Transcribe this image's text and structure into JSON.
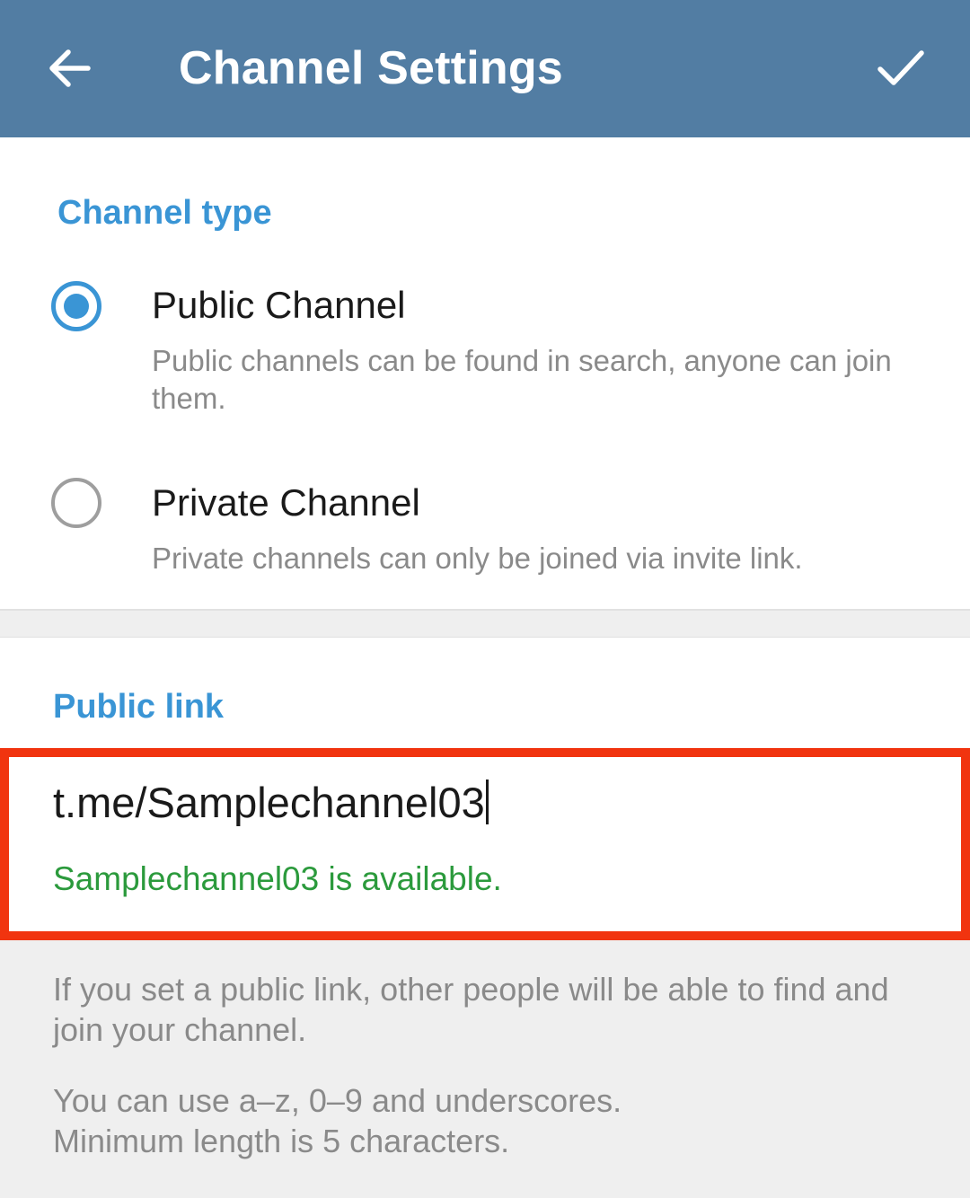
{
  "app_bar": {
    "back_icon": "arrow-left-icon",
    "title": "Channel Settings",
    "done_icon": "checkmark-icon",
    "background_color": "#527da3"
  },
  "channel_type": {
    "header": "Channel type",
    "options": [
      {
        "label": "Public Channel",
        "description": "Public channels can be found in search, anyone can join them.",
        "selected": true
      },
      {
        "label": "Private Channel",
        "description": "Private channels can only be joined via invite link.",
        "selected": false
      }
    ]
  },
  "public_link": {
    "header": "Public link",
    "value": "t.me/Samplechannel03",
    "status": "Samplechannel03 is available.",
    "status_color": "#2b9a3c",
    "highlight_color": "#f1340f"
  },
  "info": {
    "paragraph1": "If you set a public link, other people will be able to find and join your channel.",
    "paragraph2_line1": "You can use a–z, 0–9 and underscores.",
    "paragraph2_line2": "Minimum length is 5 characters."
  },
  "accent_color": "#3a95d5"
}
